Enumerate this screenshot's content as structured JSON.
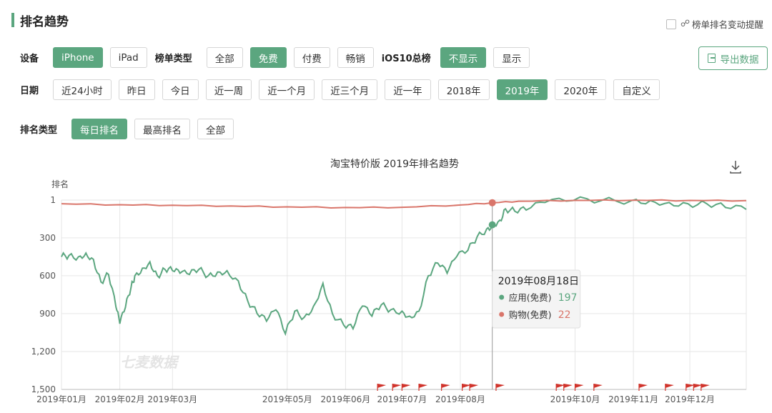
{
  "header": {
    "title": "排名趋势"
  },
  "notify": {
    "label": "榜单排名变动提醒"
  },
  "filters": {
    "device": {
      "label": "设备",
      "options": [
        "iPhone",
        "iPad"
      ],
      "active": 0
    },
    "list_type": {
      "label": "榜单类型",
      "options": [
        "全部",
        "免费",
        "付费",
        "畅销"
      ],
      "active": 1
    },
    "ios10": {
      "label": "iOS10总榜",
      "options": [
        "不显示",
        "显示"
      ],
      "active": 0
    },
    "date": {
      "label": "日期",
      "options": [
        "近24小时",
        "昨日",
        "今日",
        "近一周",
        "近一个月",
        "近三个月",
        "近一年",
        "2018年",
        "2019年",
        "2020年",
        "自定义"
      ],
      "active": 8
    },
    "rank_type": {
      "label": "排名类型",
      "options": [
        "每日排名",
        "最高排名",
        "全部"
      ],
      "active": 0
    }
  },
  "export": {
    "label": "导出数据"
  },
  "colors": {
    "accent": "#5ba67f",
    "app_series": "#5ba67f",
    "shopping_series": "#d9756a",
    "flag": "#d0342c"
  },
  "chart_data": {
    "type": "line",
    "title": "淘宝特价版 2019年排名趋势",
    "ylabel": "排名",
    "y_inverted": true,
    "ylim": [
      1,
      1500
    ],
    "yticks": [
      "1",
      "300",
      "600",
      "900",
      "1,200",
      "1,500"
    ],
    "xticks": [
      "2019年01月",
      "2019年02月",
      "2019年03月",
      "2019年05月",
      "2019年06月",
      "2019年07月",
      "2019年08月",
      "2019年10月",
      "2019年11月",
      "2019年12月"
    ],
    "watermark": "七麦数据",
    "grid": true,
    "series": [
      {
        "name": "应用(免费)",
        "color": "#5ba67f",
        "points": [
          [
            "2019-01-01",
            450
          ],
          [
            "2019-01-05",
            440
          ],
          [
            "2019-01-10",
            450
          ],
          [
            "2019-01-14",
            420
          ],
          [
            "2019-01-18",
            470
          ],
          [
            "2019-01-22",
            650
          ],
          [
            "2019-01-26",
            590
          ],
          [
            "2019-01-30",
            850
          ],
          [
            "2019-02-01",
            980
          ],
          [
            "2019-02-04",
            850
          ],
          [
            "2019-02-07",
            690
          ],
          [
            "2019-02-09",
            600
          ],
          [
            "2019-02-13",
            540
          ],
          [
            "2019-02-17",
            490
          ],
          [
            "2019-02-21",
            600
          ],
          [
            "2019-02-25",
            550
          ],
          [
            "2019-03-01",
            560
          ],
          [
            "2019-03-05",
            580
          ],
          [
            "2019-03-10",
            590
          ],
          [
            "2019-03-15",
            550
          ],
          [
            "2019-03-20",
            600
          ],
          [
            "2019-03-25",
            570
          ],
          [
            "2019-03-30",
            560
          ],
          [
            "2019-04-05",
            640
          ],
          [
            "2019-04-10",
            800
          ],
          [
            "2019-04-15",
            900
          ],
          [
            "2019-04-20",
            960
          ],
          [
            "2019-04-25",
            870
          ],
          [
            "2019-04-30",
            1060
          ],
          [
            "2019-05-05",
            880
          ],
          [
            "2019-05-10",
            930
          ],
          [
            "2019-05-15",
            840
          ],
          [
            "2019-05-20",
            660
          ],
          [
            "2019-05-25",
            900
          ],
          [
            "2019-05-31",
            990
          ],
          [
            "2019-06-05",
            1020
          ],
          [
            "2019-06-10",
            840
          ],
          [
            "2019-06-15",
            920
          ],
          [
            "2019-06-20",
            830
          ],
          [
            "2019-06-25",
            870
          ],
          [
            "2019-07-01",
            880
          ],
          [
            "2019-07-05",
            920
          ],
          [
            "2019-07-10",
            880
          ],
          [
            "2019-07-15",
            600
          ],
          [
            "2019-07-20",
            500
          ],
          [
            "2019-07-25",
            580
          ],
          [
            "2019-07-30",
            450
          ],
          [
            "2019-08-05",
            400
          ],
          [
            "2019-08-10",
            290
          ],
          [
            "2019-08-15",
            230
          ],
          [
            "2019-08-18",
            197
          ],
          [
            "2019-08-22",
            160
          ],
          [
            "2019-08-25",
            70
          ],
          [
            "2019-08-30",
            90
          ],
          [
            "2019-09-05",
            80
          ],
          [
            "2019-09-15",
            20
          ],
          [
            "2019-09-30",
            5
          ],
          [
            "2019-10-15",
            5
          ],
          [
            "2019-10-31",
            5
          ],
          [
            "2019-11-10",
            5
          ],
          [
            "2019-11-20",
            20
          ],
          [
            "2019-11-30",
            30
          ],
          [
            "2019-12-10",
            30
          ],
          [
            "2019-12-20",
            60
          ],
          [
            "2019-12-31",
            75
          ]
        ]
      },
      {
        "name": "购物(免费)",
        "color": "#d9756a",
        "points": [
          [
            "2019-01-01",
            30
          ],
          [
            "2019-02-01",
            38
          ],
          [
            "2019-03-01",
            42
          ],
          [
            "2019-04-01",
            48
          ],
          [
            "2019-05-01",
            55
          ],
          [
            "2019-06-01",
            60
          ],
          [
            "2019-07-01",
            58
          ],
          [
            "2019-08-01",
            40
          ],
          [
            "2019-08-18",
            22
          ],
          [
            "2019-09-01",
            10
          ],
          [
            "2019-10-01",
            3
          ],
          [
            "2019-11-01",
            2
          ],
          [
            "2019-12-01",
            4
          ],
          [
            "2019-12-31",
            5
          ]
        ]
      }
    ],
    "tooltip": {
      "date": "2019年08月18日",
      "rows": [
        {
          "name": "应用(免费)",
          "value": "197"
        },
        {
          "name": "购物(免费)",
          "value": "22"
        }
      ]
    }
  }
}
